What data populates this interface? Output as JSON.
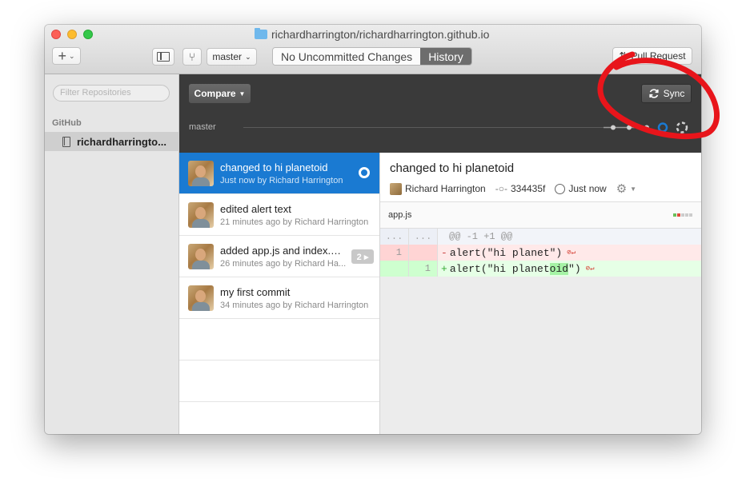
{
  "window": {
    "title": "richardharrington/richardharrington.github.io"
  },
  "toolbar": {
    "add_label": "+",
    "branch_label": "master",
    "uncommitted_label": "No Uncommitted Changes",
    "history_label": "History",
    "pull_request_label": "Pull Request"
  },
  "sidebar": {
    "filter_placeholder": "Filter Repositories",
    "section_heading": "GitHub",
    "repo_label": "richardharringto..."
  },
  "darkbar": {
    "compare_label": "Compare",
    "sync_label": "Sync",
    "branch_label": "master"
  },
  "commits": [
    {
      "title": "changed to hi planetoid",
      "subtitle": "Just now by Richard Harrington"
    },
    {
      "title": "edited alert text",
      "subtitle": "21 minutes ago by Richard Harrington"
    },
    {
      "title": "added app.js and index.…",
      "subtitle": "26 minutes ago by Richard Ha...",
      "badge": "2 ▸"
    },
    {
      "title": "my first commit",
      "subtitle": "34 minutes ago by Richard Harrington"
    }
  ],
  "detail": {
    "title": "changed to hi planetoid",
    "author": "Richard Harrington",
    "sha": "334435f",
    "time": "Just now",
    "file_name": "app.js",
    "hunk_header": "@@ -1 +1 @@",
    "hunk_left": "...",
    "hunk_right": "...",
    "deleted_line_no": "1",
    "deleted_marker": "-",
    "deleted_code": "alert(\"hi planet\")",
    "added_line_no": "1",
    "added_marker": "+",
    "added_code_before": "alert(\"hi planet",
    "added_code_highlight": "oid",
    "added_code_after": "\")"
  },
  "colors": {
    "accent": "#1a7ad2",
    "annotation": "#e8151b"
  }
}
